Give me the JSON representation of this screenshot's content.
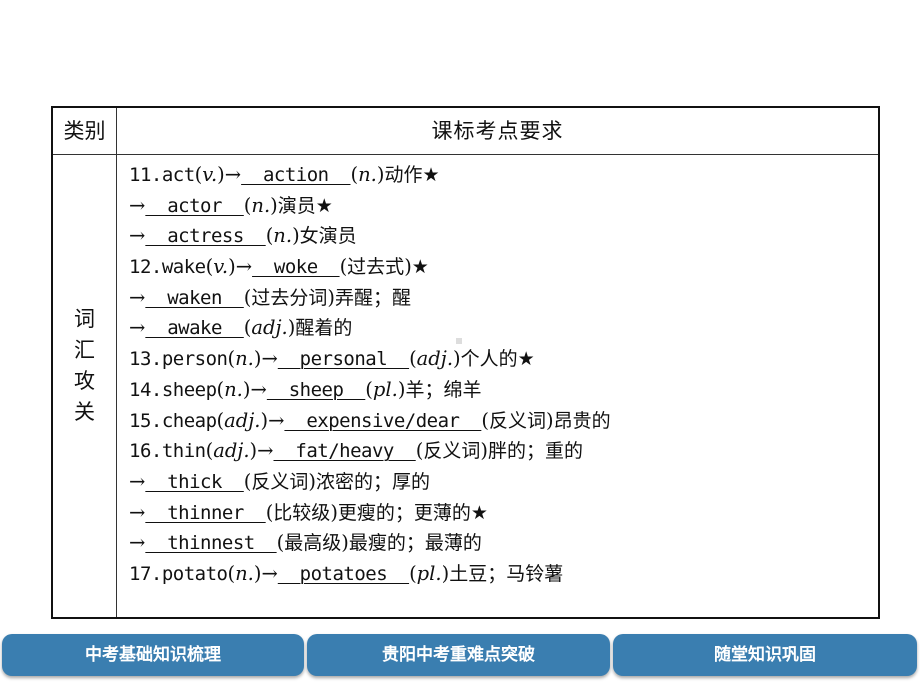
{
  "table": {
    "header": {
      "category": "类别",
      "requirement": "课标考点要求"
    },
    "category_vertical": [
      "词",
      "汇",
      "攻",
      "关"
    ],
    "lines": [
      {
        "prefix": "11.act",
        "pos1": "v.",
        "arrow": "→",
        "answer": "  action  ",
        "pos2": "n.",
        "suffix": "动作★"
      },
      {
        "prefix": "",
        "pos1": "",
        "arrow": "→",
        "answer": "  actor  ",
        "pos2": "n.",
        "suffix": "演员★"
      },
      {
        "prefix": "",
        "pos1": "",
        "arrow": "→",
        "answer": "  actress  ",
        "pos2": "n.",
        "suffix": "女演员"
      },
      {
        "prefix": "12.wake",
        "pos1": "v.",
        "arrow": "→",
        "answer": "  woke  ",
        "note": "过去式",
        "suffix": "★"
      },
      {
        "prefix": "",
        "pos1": "",
        "arrow": "→",
        "answer": "  waken  ",
        "note": "过去分词",
        "suffix": "弄醒；醒"
      },
      {
        "prefix": "",
        "pos1": "",
        "arrow": "→",
        "answer": "  awake  ",
        "pos2": "adj.",
        "suffix": "醒着的"
      },
      {
        "prefix": "13.person",
        "pos1": "n.",
        "arrow": "→",
        "answer": "  personal  ",
        "pos2": "adj.",
        "suffix": "个人的★"
      },
      {
        "prefix": "14.sheep",
        "pos1": "n.",
        "arrow": "→",
        "answer": "  sheep  ",
        "pos2": "pl.",
        "suffix": "羊；绵羊"
      },
      {
        "prefix": "15.cheap",
        "pos1": "adj.",
        "arrow": "→",
        "answer": "  expensive/dear  ",
        "note": "反义词",
        "suffix": "昂贵的"
      },
      {
        "prefix": "16.thin",
        "pos1": "adj.",
        "arrow": "→",
        "answer": "  fat/heavy  ",
        "note": "反义词",
        "suffix": "胖的；重的"
      },
      {
        "prefix": "",
        "pos1": "",
        "arrow": "→",
        "answer": "  thick  ",
        "note": "反义词",
        "suffix": "浓密的；厚的"
      },
      {
        "prefix": "",
        "pos1": "",
        "arrow": "→",
        "answer": "  thinner  ",
        "note": "比较级",
        "suffix": "更瘦的；更薄的★"
      },
      {
        "prefix": "",
        "pos1": "",
        "arrow": "→",
        "answer": "  thinnest  ",
        "note": "最高级",
        "suffix": "最瘦的；最薄的"
      },
      {
        "prefix": "17.potato",
        "pos1": "n.",
        "arrow": "→",
        "answer": "  potatoes  ",
        "pos2": "pl.",
        "suffix": "土豆；马铃薯"
      }
    ]
  },
  "nav": {
    "buttons": [
      {
        "label": "中考基础知识梳理"
      },
      {
        "label": "贵阳中考重难点突破"
      },
      {
        "label": "随堂知识巩固"
      }
    ],
    "color": "#3a7eb0"
  }
}
